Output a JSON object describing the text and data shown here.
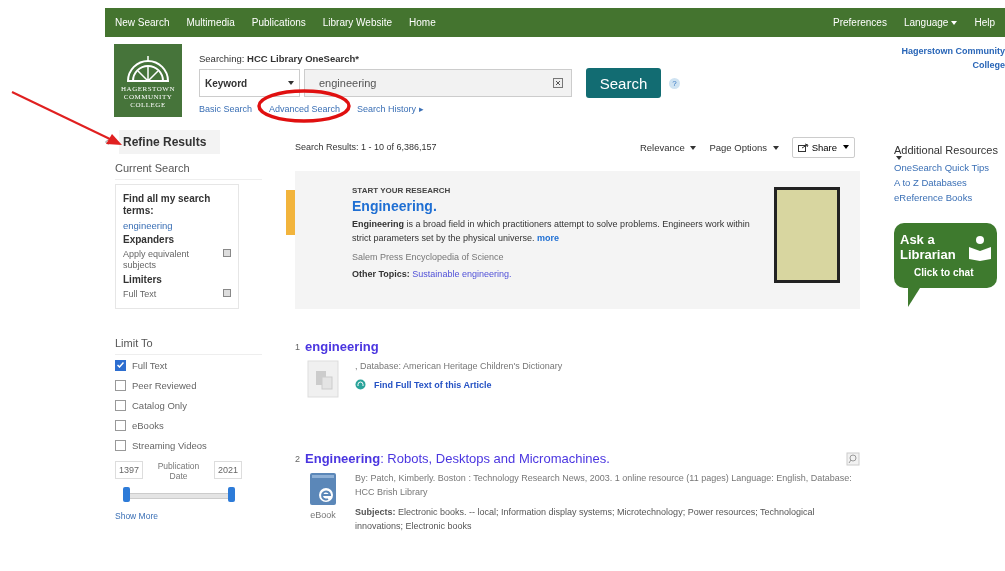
{
  "nav": {
    "left": [
      "New Search",
      "Multimedia",
      "Publications",
      "Library Website",
      "Home"
    ],
    "right": [
      "Preferences",
      "Language",
      "Help"
    ]
  },
  "header": {
    "logo_lines": [
      "HAGERSTOWN",
      "COMMUNITY",
      "COLLEGE"
    ],
    "searching_label": "Searching:",
    "searching_value": "HCC Library OneSearch*",
    "field": "Keyword",
    "query": "engineering",
    "button": "Search",
    "help": "?",
    "links": [
      "Basic Search",
      "Advanced Search",
      "Search History ▸"
    ],
    "institution": "Hagerstown Community College"
  },
  "sidebar": {
    "title": "Refine Results",
    "current_search": {
      "title": "Current Search",
      "items": [
        {
          "kind": "heading",
          "text": "Find all my search terms:"
        },
        {
          "kind": "link",
          "text": "engineering"
        },
        {
          "kind": "heading",
          "text": "Expanders"
        },
        {
          "kind": "removable",
          "text": "Apply equivalent subjects"
        },
        {
          "kind": "heading",
          "text": "Limiters"
        },
        {
          "kind": "removable",
          "text": "Full Text"
        }
      ]
    },
    "limit_to": {
      "title": "Limit To",
      "options": [
        {
          "label": "Full Text",
          "checked": true
        },
        {
          "label": "Peer Reviewed",
          "checked": false
        },
        {
          "label": "Catalog Only",
          "checked": false
        },
        {
          "label": "eBooks",
          "checked": false
        },
        {
          "label": "Streaming Videos",
          "checked": false
        }
      ],
      "date_from": "1397",
      "date_label": "Publication Date",
      "date_to": "2021",
      "level": 1
    },
    "show_more": "Show More"
  },
  "toolbar": {
    "count": "Search Results: 1 - 10 of 6,386,157",
    "sort": "Relevance",
    "page_options": "Page Options",
    "share": "Share"
  },
  "research": {
    "eyebrow": "START YOUR RESEARCH",
    "title": "Engineering.",
    "description": "**Engineering** is a broad field in which practitioners attempt to solve problems. Engineers work within strict parameters set by the physical universe.",
    "more": "more",
    "source": "Salem Press Encyclopedia of Science",
    "topics_label": "Other Topics:",
    "topics_link": "Sustainable engineering."
  },
  "results": [
    {
      "kind": "article",
      "number": "1",
      "title": "engineering",
      "meta": ", Database: American Heritage Children's Dictionary",
      "link": "Find Full Text of this Article"
    },
    {
      "kind": "ebook",
      "number": "2",
      "title": "Engineering",
      "subtitle": ": Robots, Desktops and Micromachines.",
      "meta": "By: Patch, Kimberly. Boston : Technology Research News, 2003. 1 online resource (11 pages) Language: English, Database: HCC Brish Library",
      "subjects_label": "Subjects:",
      "subjects": "Electronic books. -- local; Information display systems; Microtechnology; Power resources; Technological innovations; Electronic books",
      "type_label": "eBook"
    }
  ],
  "resources": {
    "title": "Additional Resources",
    "links": [
      "OneSearch Quick Tips",
      "A to Z Databases",
      "eReference Books"
    ],
    "chat": [
      "Ask a",
      "Librarian",
      "Click to chat"
    ]
  }
}
